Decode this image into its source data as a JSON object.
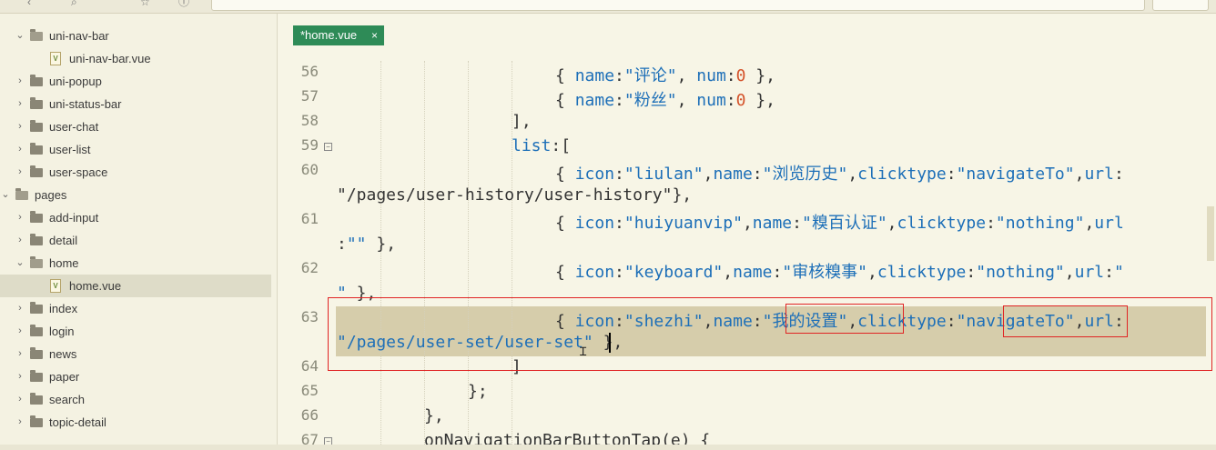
{
  "window": {
    "toolbar_icons": [
      "back-icon",
      "search-icon",
      "star-icon",
      "info-icon"
    ]
  },
  "sidebar": {
    "items": [
      {
        "label": "uni-nav-bar",
        "type": "folder",
        "expanded": true,
        "depth": 1
      },
      {
        "label": "uni-nav-bar.vue",
        "type": "file",
        "depth": 2
      },
      {
        "label": "uni-popup",
        "type": "folder",
        "expanded": false,
        "depth": 1
      },
      {
        "label": "uni-status-bar",
        "type": "folder",
        "expanded": false,
        "depth": 1
      },
      {
        "label": "user-chat",
        "type": "folder",
        "expanded": false,
        "depth": 1
      },
      {
        "label": "user-list",
        "type": "folder",
        "expanded": false,
        "depth": 1
      },
      {
        "label": "user-space",
        "type": "folder",
        "expanded": false,
        "depth": 1
      },
      {
        "label": "pages",
        "type": "folder",
        "expanded": true,
        "depth": 0
      },
      {
        "label": "add-input",
        "type": "folder",
        "expanded": false,
        "depth": 1
      },
      {
        "label": "detail",
        "type": "folder",
        "expanded": false,
        "depth": 1
      },
      {
        "label": "home",
        "type": "folder",
        "expanded": true,
        "depth": 1
      },
      {
        "label": "home.vue",
        "type": "file",
        "depth": 2,
        "selected": true
      },
      {
        "label": "index",
        "type": "folder",
        "expanded": false,
        "depth": 1
      },
      {
        "label": "login",
        "type": "folder",
        "expanded": false,
        "depth": 1
      },
      {
        "label": "news",
        "type": "folder",
        "expanded": false,
        "depth": 1
      },
      {
        "label": "paper",
        "type": "folder",
        "expanded": false,
        "depth": 1
      },
      {
        "label": "search",
        "type": "folder",
        "expanded": false,
        "depth": 1
      },
      {
        "label": "topic-detail",
        "type": "folder",
        "expanded": false,
        "depth": 1
      }
    ]
  },
  "editor": {
    "tab": {
      "label": "*home.vue",
      "close": "×"
    },
    "line_numbers": [
      "56",
      "57",
      "58",
      "59",
      "60",
      "",
      "61",
      "",
      "62",
      "",
      "63",
      "",
      "64",
      "65",
      "66",
      "67"
    ],
    "code": {
      "l56": [
        "{ ",
        "name",
        ":",
        "\"评论\"",
        ", ",
        "num",
        ":",
        "0",
        " },"
      ],
      "l57": [
        "{ ",
        "name",
        ":",
        "\"粉丝\"",
        ", ",
        "num",
        ":",
        "0",
        " },"
      ],
      "l58": "],",
      "l59": [
        "list",
        ":["
      ],
      "l60": [
        "{ ",
        "icon",
        ":",
        "\"liulan\"",
        ",",
        "name",
        ":",
        "\"浏览历史\"",
        ",",
        "clicktype",
        ":",
        "\"navigateTo\"",
        ",",
        "url",
        ":"
      ],
      "l60b": "\"/pages/user-history/user-history\"},",
      "l61": [
        "{ ",
        "icon",
        ":",
        "\"huiyuanvip\"",
        ",",
        "name",
        ":",
        "\"糗百认证\"",
        ",",
        "clicktype",
        ":",
        "\"nothing\"",
        ",",
        "url"
      ],
      "l61b": [
        ":",
        "\"\"",
        " },"
      ],
      "l62": [
        "{ ",
        "icon",
        ":",
        "\"keyboard\"",
        ",",
        "name",
        ":",
        "\"审核糗事\"",
        ",",
        "clicktype",
        ":",
        "\"nothing\"",
        ",",
        "url",
        ":",
        "\""
      ],
      "l62b": [
        "\"",
        " },"
      ],
      "l63": [
        "{ ",
        "icon",
        ":",
        "\"shezhi\"",
        ",",
        "name",
        ":",
        "\"我的设置\"",
        ",",
        "clicktype",
        ":",
        "\"navigateTo\"",
        ",",
        "url",
        ":"
      ],
      "l63b": [
        "\"/pages/user-set/user-set\"",
        " },"
      ],
      "l64": "]",
      "l65": "};",
      "l66": "},",
      "l67": "onNavigationBarButtonTap(e) {"
    }
  }
}
